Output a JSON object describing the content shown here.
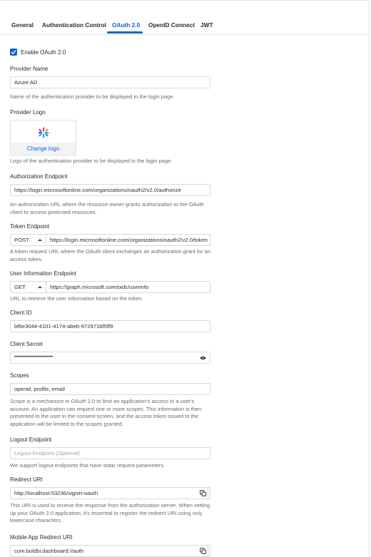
{
  "tabs": [
    {
      "label": "General"
    },
    {
      "label": "Authentication Control"
    },
    {
      "label": "OAuth 2.0"
    },
    {
      "label": "OpenID Connect"
    },
    {
      "label": "JWT"
    }
  ],
  "active_tab": "OAuth 2.0",
  "enable": {
    "label": "Enable OAuth 2.0",
    "checked": true
  },
  "provider_name": {
    "label": "Provider Name",
    "value": "Azure AD",
    "help": "Name of the authentication provider to be displayed in the login page."
  },
  "provider_logo": {
    "label": "Provider Logo",
    "change_label": "Change logo",
    "help": "Logo of the authentication provider to be displayed in the login page."
  },
  "authorization_endpoint": {
    "label": "Authorization Endpoint",
    "value": "https://login.microsoftonline.com/organizations/oauth2/v2.0/authorize",
    "help": "An authorization URL where the resource owner grants authorization to the OAuth client to access protected resources."
  },
  "token_endpoint": {
    "label": "Token Endpoint",
    "method": "POST",
    "value": "https://login.microsoftonline.com/organizations/oauth2/v2.0/token",
    "help": "A token request URL where the OAuth client exchanges an authorization grant for an access token."
  },
  "user_info_endpoint": {
    "label": "User Information Endpoint",
    "method": "GET",
    "value": "https://graph.microsoft.com/oidc/userinfo",
    "help": "URL to retrieve the user information based on the token."
  },
  "client_id": {
    "label": "Client ID",
    "value": "bf6e3044-4101-4174-abeb-972971bf5ff9"
  },
  "client_secret": {
    "label": "Client Secret",
    "masked_value": "••••••••••••••••••••••••••••••"
  },
  "scopes": {
    "label": "Scopes",
    "value": "openid, profile, email",
    "help": "Scope is a mechanism in OAuth 2.0 to limit an application's access to a user's account. An application can request one or more scopes. This information is then presented to the user in the consent screen, and the access token issued to the application will be limited to the scopes granted."
  },
  "logout_endpoint": {
    "label": "Logout Endpoint",
    "placeholder": "Logout Endpoint (Optional)",
    "help": "We support logout endpoints that have static request parameters."
  },
  "redirect_uri": {
    "label": "Redirect URI",
    "value": "http://localhost:53236/signin-oauth",
    "help": "This URI is used to receive the response from the authorization server. When setting up your OAuth 2.0 application, it's essential to register the redirect URI using only lowercase characters."
  },
  "mobile_redirect_uri": {
    "label": "Mobile App Redirect URI",
    "value": "com.boldbi.dashboard://auth"
  },
  "colors": {
    "accent": "#0b62d6",
    "border": "#d9d9d9",
    "help_text": "#6a6a6a"
  }
}
